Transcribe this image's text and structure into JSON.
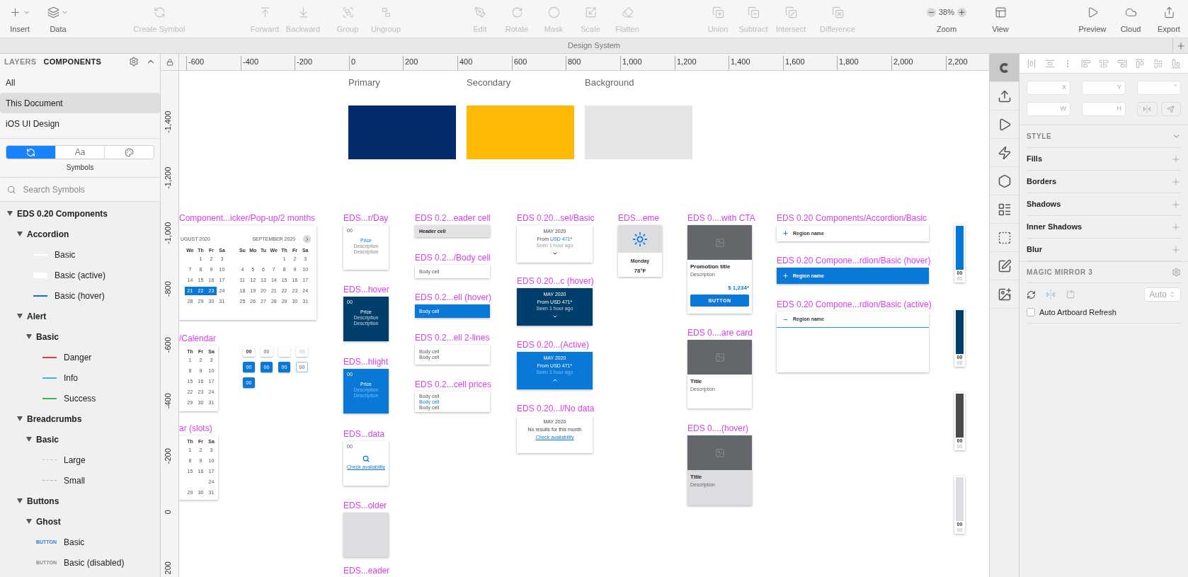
{
  "toolbar": [
    {
      "label": "Insert",
      "kind": "menu",
      "disabled": false
    },
    {
      "label": "Data",
      "kind": "menu",
      "disabled": false
    },
    {
      "label": "Create Symbol",
      "kind": "button",
      "disabled": true
    },
    {
      "label": "Forward",
      "kind": "button",
      "disabled": true
    },
    {
      "label": "Backward",
      "kind": "button",
      "disabled": true
    },
    {
      "label": "Group",
      "kind": "button",
      "disabled": true
    },
    {
      "label": "Ungroup",
      "kind": "button",
      "disabled": true
    },
    {
      "label": "Edit",
      "kind": "button",
      "disabled": true
    },
    {
      "label": "Rotate",
      "kind": "button",
      "disabled": true
    },
    {
      "label": "Mask",
      "kind": "button",
      "disabled": true
    },
    {
      "label": "Scale",
      "kind": "button",
      "disabled": true
    },
    {
      "label": "Flatten",
      "kind": "button",
      "disabled": true
    },
    {
      "label": "Union",
      "kind": "button",
      "disabled": true
    },
    {
      "label": "Subtract",
      "kind": "button",
      "disabled": true
    },
    {
      "label": "Intersect",
      "kind": "button",
      "disabled": true
    },
    {
      "label": "Difference",
      "kind": "button",
      "disabled": true
    },
    {
      "label": "Zoom",
      "kind": "zoom",
      "value": "38%",
      "disabled": false
    },
    {
      "label": "View",
      "kind": "menu",
      "disabled": false
    },
    {
      "label": "Preview",
      "kind": "button",
      "disabled": false
    },
    {
      "label": "Cloud",
      "kind": "button",
      "disabled": false
    },
    {
      "label": "Export",
      "kind": "button",
      "disabled": false
    }
  ],
  "document_title": "Design System",
  "left_panel": {
    "tabs": [
      {
        "label": "LAYERS",
        "selected": false
      },
      {
        "label": "COMPONENTS",
        "selected": true
      }
    ],
    "libraries": [
      {
        "label": "All",
        "selected": false
      },
      {
        "label": "This Document",
        "selected": true
      },
      {
        "label": "iOS UI Design",
        "selected": false
      }
    ],
    "segments": [
      {
        "kind": "symbols",
        "selected": true
      },
      {
        "kind": "text",
        "label": "Aa",
        "selected": false
      },
      {
        "kind": "styles",
        "selected": false
      }
    ],
    "segment_caption": "Symbols",
    "search": {
      "placeholder": "Search Symbols"
    },
    "tree": [
      {
        "label": "EDS 0.20 Components",
        "expanded": true,
        "children": [
          {
            "label": "Accordion",
            "expanded": true,
            "children": [
              {
                "label": "Basic",
                "thumb": {
                  "kind": "line",
                  "color": "#ffffff"
                }
              },
              {
                "label": "Basic (active)",
                "thumb": {
                  "kind": "block",
                  "color": "#ffffff"
                }
              },
              {
                "label": "Basic (hover)",
                "thumb": {
                  "kind": "line",
                  "color": "#0b6fd6"
                }
              }
            ]
          },
          {
            "label": "Alert",
            "expanded": true,
            "children": [
              {
                "label": "Basic",
                "expanded": true,
                "children": [
                  {
                    "label": "Danger",
                    "thumb": {
                      "kind": "line",
                      "color": "#e0393e"
                    }
                  },
                  {
                    "label": "Info",
                    "thumb": {
                      "kind": "line",
                      "color": "#3db6d8"
                    }
                  },
                  {
                    "label": "Success",
                    "thumb": {
                      "kind": "line",
                      "color": "#3eb649"
                    }
                  }
                ]
              }
            ]
          },
          {
            "label": "Breadcrumbs",
            "expanded": true,
            "children": [
              {
                "label": "Basic",
                "expanded": true,
                "children": [
                  {
                    "label": "Large",
                    "thumb": {
                      "kind": "dash",
                      "color": "#9fc3e6"
                    }
                  },
                  {
                    "label": "Small",
                    "thumb": {
                      "kind": "dash",
                      "color": "#a9a9a9"
                    }
                  }
                ]
              }
            ]
          },
          {
            "label": "Buttons",
            "expanded": true,
            "children": [
              {
                "label": "Ghost",
                "expanded": true,
                "children": [
                  {
                    "label": "Basic",
                    "thumb": {
                      "kind": "text",
                      "text": "BUTTON",
                      "color": "#2f7fd6"
                    }
                  },
                  {
                    "label": "Basic (disabled)",
                    "thumb": {
                      "kind": "text",
                      "text": "BUTTON",
                      "color": "#8a8a8a"
                    }
                  }
                ]
              }
            ]
          }
        ]
      }
    ]
  },
  "rulers": {
    "horizontal": [
      "-600",
      "-400",
      "-200",
      "0",
      "200",
      "400",
      "600",
      "800",
      "1,000",
      "1,200",
      "1,400",
      "1,600",
      "1,800",
      "2,000",
      "2,200"
    ],
    "vertical": [
      "-1,400",
      "-1,200",
      "-1,000",
      "-800",
      "-600",
      "-400",
      "-200",
      "0",
      "200"
    ]
  },
  "canvas": {
    "swatches": [
      {
        "label": "Primary",
        "color": "#022b6b"
      },
      {
        "label": "Secondary",
        "color": "#feb902"
      },
      {
        "label": "Background",
        "color": "#e5e5e5"
      }
    ],
    "date_picker": {
      "title": "Component...icker/Pop-up/2 months",
      "months": [
        {
          "title": "UGUST 2020",
          "weekdays": [
            "We",
            "Th",
            "Fr",
            "Sa"
          ],
          "weeks": [
            [
              {
                "d": "1",
                "selected": false
              },
              {
                "d": "2",
                "selected": false
              },
              {
                "d": "3",
                "selected": false
              }
            ],
            [
              {
                "d": "7",
                "selected": false
              },
              {
                "d": "8",
                "selected": false
              },
              {
                "d": "9",
                "selected": false
              },
              {
                "d": "10",
                "selected": false
              }
            ],
            [
              {
                "d": "14",
                "selected": false
              },
              {
                "d": "15",
                "selected": false
              },
              {
                "d": "16",
                "selected": false
              },
              {
                "d": "17",
                "selected": false
              }
            ],
            [
              {
                "d": "21",
                "selected": true
              },
              {
                "d": "22",
                "selected": true
              },
              {
                "d": "23",
                "selected": true
              },
              {
                "d": "24",
                "selected": false
              }
            ],
            [
              {
                "d": "28",
                "selected": false
              },
              {
                "d": "29",
                "selected": false
              },
              {
                "d": "30",
                "selected": false
              },
              {
                "d": "31",
                "selected": false
              }
            ]
          ]
        },
        {
          "title": "SEPTEMBER 2020",
          "weekdays": [
            "Su",
            "Mo",
            "Tu",
            "We",
            "Th",
            "Fr",
            "Sa"
          ],
          "weeks": [
            [
              {
                "d": "1",
                "selected": false
              },
              {
                "d": "2",
                "selected": false
              },
              {
                "d": "3",
                "selected": false
              }
            ],
            [
              {
                "d": "4",
                "selected": false
              },
              {
                "d": "5",
                "selected": false
              },
              {
                "d": "6",
                "selected": false
              },
              {
                "d": "7",
                "selected": false
              },
              {
                "d": "8",
                "selected": false
              },
              {
                "d": "9",
                "selected": false
              },
              {
                "d": "10",
                "selected": false
              }
            ],
            [
              {
                "d": "11",
                "selected": false
              },
              {
                "d": "12",
                "selected": false
              },
              {
                "d": "13",
                "selected": false
              },
              {
                "d": "14",
                "selected": false
              },
              {
                "d": "15",
                "selected": false
              },
              {
                "d": "16",
                "selected": false
              },
              {
                "d": "17",
                "selected": false
              }
            ],
            [
              {
                "d": "18",
                "selected": false
              },
              {
                "d": "19",
                "selected": false
              },
              {
                "d": "20",
                "selected": false
              },
              {
                "d": "21",
                "selected": false
              },
              {
                "d": "22",
                "selected": false
              },
              {
                "d": "23",
                "selected": false
              },
              {
                "d": "24",
                "selected": false
              }
            ],
            [
              {
                "d": "25",
                "selected": false
              },
              {
                "d": "26",
                "selected": false
              },
              {
                "d": "27",
                "selected": false
              },
              {
                "d": "28",
                "selected": false
              },
              {
                "d": "29",
                "selected": false
              },
              {
                "d": "30",
                "selected": false
              },
              {
                "d": "31",
                "selected": false
              }
            ]
          ]
        }
      ]
    },
    "calendars": [
      {
        "title": "/Calendar",
        "weekdays": [
          "Th",
          "Fr",
          "Sa"
        ],
        "weeks": [
          [
            "1",
            "2",
            "3"
          ],
          [
            "8",
            "9",
            "10"
          ],
          [
            "15",
            "16",
            "17"
          ],
          [
            "22",
            "23",
            "24"
          ],
          [
            "29",
            "30",
            "31"
          ]
        ]
      },
      {
        "title": "ar (slots)",
        "weekdays": [
          "Th",
          "Fr",
          "Sa"
        ],
        "weeks": [
          [
            "1",
            "2",
            "3"
          ],
          [
            "8",
            "9",
            "10"
          ],
          [
            "15",
            "16",
            "17"
          ],
          [
            "24"
          ],
          [
            "29",
            "30",
            "31"
          ]
        ]
      }
    ],
    "day_cells": [
      {
        "text": "00",
        "kind": "bold"
      },
      {
        "text": "00",
        "kind": "default"
      },
      {
        "kind": "empty"
      },
      {
        "text": "00",
        "kind": "disabled"
      },
      {
        "text": "00",
        "kind": "selected"
      },
      {
        "text": "00",
        "kind": "selected"
      },
      {
        "text": "00",
        "kind": "selected"
      },
      {
        "text": "00",
        "kind": "outlined"
      },
      {
        "text": "00",
        "kind": "selected"
      }
    ],
    "day_cards": [
      {
        "title": "EDS...r/Day",
        "kind": "default",
        "day": "00",
        "price": "Price",
        "descriptions": [
          "Description",
          "Description"
        ]
      },
      {
        "title": "EDS...hover",
        "kind": "hover",
        "day": "00",
        "price": "Price",
        "descriptions": [
          "Description",
          "Description"
        ]
      },
      {
        "title": "EDS...hlight",
        "kind": "highlight",
        "day": "00",
        "price": "Price",
        "descriptions": [
          "Description",
          "Description"
        ]
      },
      {
        "title": "EDS...data",
        "kind": "no_data",
        "day": "00",
        "link": "Check availability"
      },
      {
        "title": "EDS...older",
        "kind": "placeholder"
      },
      {
        "title": "EDS...eader",
        "kind": "offscreen"
      }
    ],
    "table_cells": [
      {
        "title": "EDS 0.2...eader cell",
        "kind": "header",
        "lines": [
          {
            "text": "Header cell",
            "highlighted": false
          }
        ]
      },
      {
        "title": "EDS 0.2.../Body cell",
        "kind": "body",
        "lines": [
          {
            "text": "Body cell",
            "highlighted": false
          }
        ]
      },
      {
        "title": "EDS 0.2...ell (hover)",
        "kind": "hover",
        "lines": [
          {
            "text": "Body cell",
            "highlighted": false
          }
        ]
      },
      {
        "title": "EDS 0.2...ell 2-lines",
        "kind": "body",
        "lines": [
          {
            "text": "Body cell",
            "highlighted": false
          },
          {
            "text": "Body cell",
            "highlighted": false
          }
        ]
      },
      {
        "title": "EDS 0.2...cell prices",
        "kind": "body",
        "lines": [
          {
            "text": "Body cell",
            "highlighted": false
          },
          {
            "text": "Body cell",
            "highlighted": true
          },
          {
            "text": "Body cell",
            "highlighted": false
          }
        ]
      }
    ],
    "carousel_cards": [
      {
        "title": "EDS 0.20...sel/Basic",
        "kind": "basic",
        "month": "MAY 2020",
        "from": "From",
        "price": "USD 471*",
        "seen": "Seen 1 hour ago"
      },
      {
        "title": "EDS 0.20...c (hover)",
        "kind": "hover",
        "month": "MAY 2020",
        "from": "From",
        "price": "USD 471*",
        "seen": "Seen 1 hour ago"
      },
      {
        "title": "EDS 0.20...(Active)",
        "kind": "active",
        "month": "MAY 2020",
        "from": "From",
        "price": "USD 471*",
        "seen": "Seen 1 hour ago"
      },
      {
        "title": "EDS 0.20...l/No data",
        "kind": "no_data",
        "month": "MAY 2020",
        "message": "No results for this month",
        "link": "Check availability"
      }
    ],
    "weather": {
      "title": "EDS...eme",
      "day": "Monday",
      "temperature": "78°F"
    },
    "promo_cards": [
      {
        "title": "EDS 0....with CTA",
        "kind": "cta",
        "heading": "Promotion title",
        "description": "Description",
        "price": "$ 1,234*",
        "button": "BUTTON"
      },
      {
        "title": "EDS 0....are card",
        "kind": "square",
        "heading": "Title",
        "description": "Description"
      },
      {
        "title": "EDS 0....(hover)",
        "kind": "hover",
        "heading": "Title",
        "description": "Description"
      }
    ],
    "accordions": [
      {
        "title": "EDS 0.20 Components/Accordion/Basic",
        "kind": "basic",
        "label": "Region name",
        "expanded": false
      },
      {
        "title": "EDS 0.20 Compone...rdion/Basic (hover)",
        "kind": "hover",
        "label": "Region name",
        "expanded": false
      },
      {
        "title": "EDS 0.20 Compone...rdion/Basic (active)",
        "kind": "basic",
        "label": "Region name",
        "expanded": true
      }
    ],
    "bars": [
      {
        "color": "#0078d7",
        "labels": [
          "00",
          "00"
        ]
      },
      {
        "color": "#003e6b",
        "labels": [
          "00",
          "00"
        ]
      },
      {
        "color": "#4a4a4a",
        "labels": [
          "00",
          "00"
        ]
      },
      {
        "color": "#dcdde0",
        "labels": [
          "00",
          "00"
        ]
      }
    ]
  },
  "inspector_tabs": [
    {
      "selected": true
    },
    {
      "selected": false
    },
    {
      "selected": false
    },
    {
      "selected": false
    },
    {
      "selected": false
    },
    {
      "selected": false
    },
    {
      "selected": false
    },
    {
      "selected": false
    },
    {
      "selected": false
    }
  ],
  "inspector": {
    "fields": [
      {
        "label": "X"
      },
      {
        "label": "Y"
      },
      {
        "label": "°"
      },
      {
        "label": "W"
      },
      {
        "label": "H"
      }
    ],
    "style_header": "STYLE",
    "style_sections": [
      "Fills",
      "Borders",
      "Shadows",
      "Inner Shadows",
      "Blur"
    ],
    "plugin": {
      "title": "MAGIC MIRROR 3",
      "select": "Auto",
      "checkbox": {
        "label": "Auto Artboard Refresh",
        "checked": false
      }
    }
  }
}
